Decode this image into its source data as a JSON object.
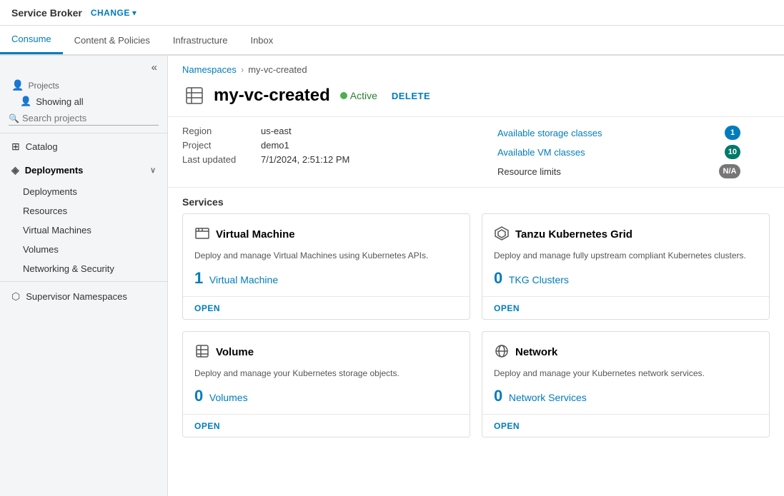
{
  "topbar": {
    "brand": "Service Broker",
    "change_label": "CHANGE",
    "chevron": "▾"
  },
  "tabs": [
    {
      "id": "consume",
      "label": "Consume",
      "active": true
    },
    {
      "id": "content-policies",
      "label": "Content & Policies",
      "active": false
    },
    {
      "id": "infrastructure",
      "label": "Infrastructure",
      "active": false
    },
    {
      "id": "inbox",
      "label": "Inbox",
      "active": false
    }
  ],
  "sidebar": {
    "collapse_icon": "«",
    "projects_label": "Projects",
    "showing_all": "Showing all",
    "search_placeholder": "Search projects",
    "nav": [
      {
        "id": "catalog",
        "label": "Catalog",
        "icon": "⊞",
        "has_sub": false
      },
      {
        "id": "deployments",
        "label": "Deployments",
        "icon": "◈",
        "active": true,
        "has_sub": true
      },
      {
        "id": "deployments-sub",
        "label": "Deployments",
        "sub": true
      },
      {
        "id": "resources-sub",
        "label": "Resources",
        "sub": true
      },
      {
        "id": "virtual-machines-sub",
        "label": "Virtual Machines",
        "sub": true
      },
      {
        "id": "volumes-sub",
        "label": "Volumes",
        "sub": true
      },
      {
        "id": "networking-security-sub",
        "label": "Networking & Security",
        "sub": true
      },
      {
        "id": "supervisor-namespaces",
        "label": "Supervisor Namespaces",
        "icon": "⬡",
        "has_sub": false
      }
    ]
  },
  "breadcrumb": {
    "parent": "Namespaces",
    "sep": "›",
    "current": "my-vc-created"
  },
  "page": {
    "title": "my-vc-created",
    "status": "Active",
    "delete_label": "DELETE",
    "region_label": "Region",
    "region_value": "us-east",
    "project_label": "Project",
    "project_value": "demo1",
    "last_updated_label": "Last updated",
    "last_updated_value": "7/1/2024, 2:51:12 PM",
    "links": [
      {
        "id": "storage-classes",
        "label": "Available storage classes",
        "badge": "1",
        "badge_type": "blue"
      },
      {
        "id": "vm-classes",
        "label": "Available VM classes",
        "badge": "10",
        "badge_type": "teal"
      },
      {
        "id": "resource-limits",
        "label": "Resource limits",
        "badge": "N/A",
        "badge_type": "gray"
      }
    ]
  },
  "services": {
    "section_label": "Services",
    "cards": [
      {
        "id": "virtual-machine",
        "title": "Virtual Machine",
        "desc": "Deploy and manage Virtual Machines using Kubernetes APIs.",
        "count_num": "1",
        "count_label": "Virtual Machine",
        "open_label": "OPEN"
      },
      {
        "id": "tanzu-kubernetes-grid",
        "title": "Tanzu Kubernetes Grid",
        "desc": "Deploy and manage fully upstream compliant Kubernetes clusters.",
        "count_num": "0",
        "count_label": "TKG Clusters",
        "open_label": "OPEN"
      },
      {
        "id": "volume",
        "title": "Volume",
        "desc": "Deploy and manage your Kubernetes storage objects.",
        "count_num": "0",
        "count_label": "Volumes",
        "open_label": "OPEN"
      },
      {
        "id": "network",
        "title": "Network",
        "desc": "Deploy and manage your Kubernetes network services.",
        "count_num": "0",
        "count_label": "Network Services",
        "open_label": "OPEN"
      }
    ]
  }
}
